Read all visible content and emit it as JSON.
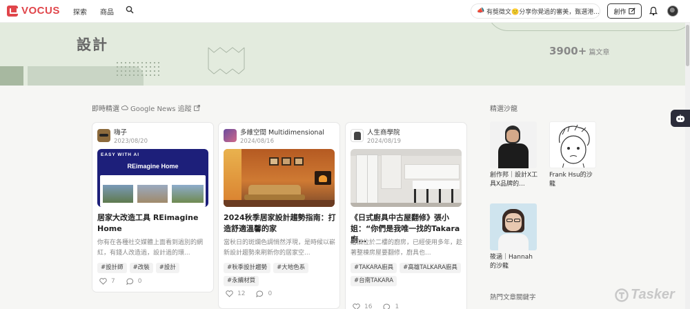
{
  "nav": {
    "logo_text": "VOCUS",
    "links": [
      "探索",
      "商品"
    ],
    "announcement": "有獎徵文🙂分享你覺過的審美，甄選港...",
    "create_label": "創作"
  },
  "hero": {
    "title": "設計",
    "count": "3900+",
    "count_label": "篇文章"
  },
  "section": {
    "title": "即時精選",
    "google_news_label": "Google News 追蹤"
  },
  "cards": [
    {
      "author": "嗨子",
      "date": "2023/08/20",
      "title": "居家大改造工具 REimagine Home",
      "excerpt": "你有在各種社交媒體上面看到過別的網紅，有錢人改造過，設計過的環...",
      "tags": [
        "#設計師",
        "#改裝",
        "#設計"
      ],
      "likes": "7",
      "comments": "0",
      "image_text": "REimagine Home",
      "image_brand": "EASY WITH AI"
    },
    {
      "author": "多維空間 Multidimensional",
      "date": "2024/08/16",
      "title": "2024秋季居家設計趨勢指南：打造舒適溫馨的家",
      "excerpt": "當秋日的斑爛色調悄然浮現，是時候以嶄新設計趨勢來刷新你的居家空...",
      "tags": [
        "#秋季設計趨勢",
        "#大地色系",
        "#永續材質"
      ],
      "likes": "12",
      "comments": "0"
    },
    {
      "author": "人生商學院",
      "date": "2024/08/19",
      "title": "《日式廚具中古屋翻修》張小姐：“你們是我唯一找的Takara廚...",
      "excerpt": "這個位於二樓的廚房，已經使用多年，趁著整棟房屋要翻修，廚具也...",
      "tags": [
        "#TAKARA廚具",
        "#高雄TALKARA廚具",
        "#台南TAKARA"
      ],
      "likes": "16",
      "comments": "1"
    }
  ],
  "sidebar": {
    "title": "精選沙龍",
    "salons": [
      {
        "name": "創作邦｜設計X工具X品牌的..."
      },
      {
        "name": "Frank Hsu的沙龍"
      },
      {
        "name": "筱涵｜Hannah的沙龍"
      }
    ],
    "keywords_title": "熱門文章關鍵字"
  },
  "watermark": "Tasker",
  "colors": {
    "brand": "#e0454a",
    "hero_bg": "#e3ebde"
  }
}
